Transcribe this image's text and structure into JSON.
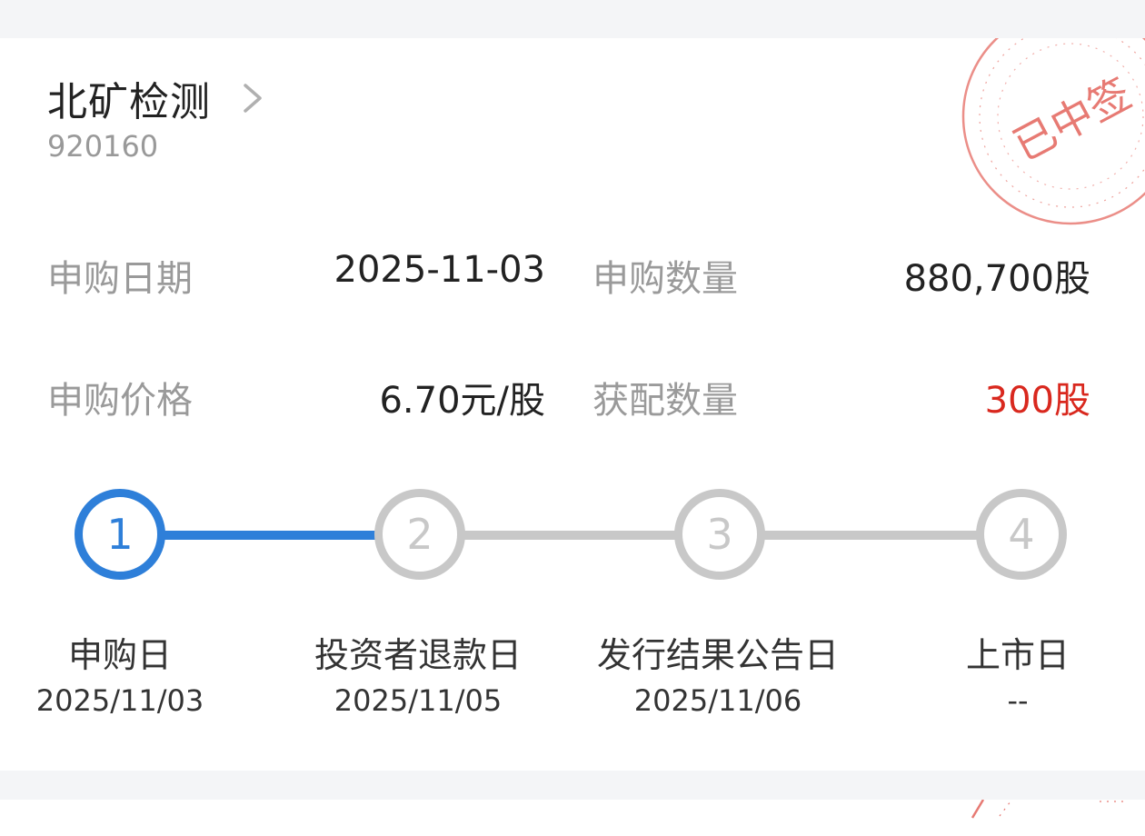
{
  "stock": {
    "name": "北矿检测",
    "code": "920160"
  },
  "stamp": {
    "text": "已中签",
    "color": "#e77a73"
  },
  "details": {
    "subscribe_date_label": "申购日期",
    "subscribe_date_value": "2025-11-03",
    "subscribe_qty_label": "申购数量",
    "subscribe_qty_value": "880,700股",
    "subscribe_price_label": "申购价格",
    "subscribe_price_value": "6.70元/股",
    "allotted_qty_label": "获配数量",
    "allotted_qty_value": "300股"
  },
  "steps": [
    {
      "num": "1",
      "label": "申购日",
      "date": "2025/11/03",
      "active": true
    },
    {
      "num": "2",
      "label": "投资者退款日",
      "date": "2025/11/05",
      "active": false
    },
    {
      "num": "3",
      "label": "发行结果公告日",
      "date": "2025/11/06",
      "active": false
    },
    {
      "num": "4",
      "label": "上市日",
      "date": "--",
      "active": false
    }
  ],
  "colors": {
    "accent": "#2e7fd9",
    "inactive": "#c8c8c8",
    "red": "#d9281e"
  }
}
